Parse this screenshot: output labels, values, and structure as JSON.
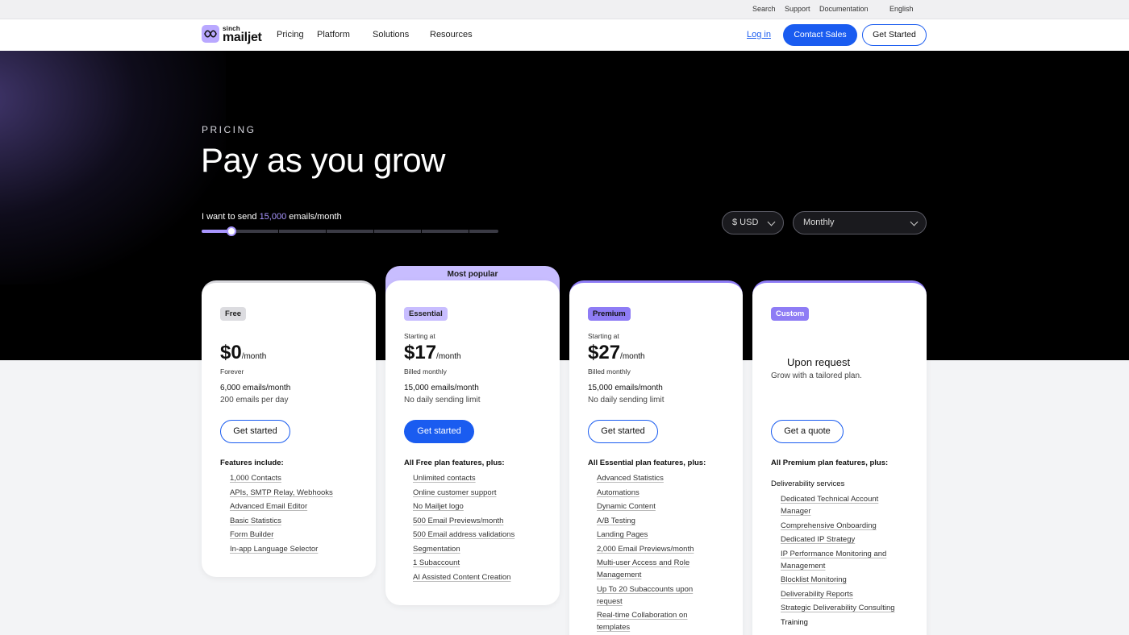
{
  "utility": {
    "search": "Search",
    "support": "Support",
    "documentation": "Documentation",
    "language": "English"
  },
  "nav": {
    "logo_brand": "sinch",
    "logo_name": "mailjet",
    "links": [
      "Pricing",
      "Platform",
      "Solutions",
      "Resources"
    ],
    "login": "Log in",
    "contact": "Contact Sales",
    "get_started": "Get Started"
  },
  "hero": {
    "eyebrow": "PRICING",
    "title": "Pay as you grow",
    "send_prefix": "I want to send",
    "send_value": "15,000",
    "send_suffix": "emails/month",
    "slider_fraction": 0.1,
    "currency": "$ USD",
    "billing": "Monthly"
  },
  "colors": {
    "primary": "#1a5cf0",
    "accent": "#8e7cf5",
    "accent_light": "#c8bdff"
  },
  "plans": {
    "most_popular": "Most popular",
    "free": {
      "badge": "Free",
      "price": "$0",
      "per": "/month",
      "note": "Forever",
      "emails": "6,000 emails/month",
      "limit": "200 emails per day",
      "cta": "Get started",
      "features_head": "Features include:",
      "features": [
        "1,000 Contacts",
        "APIs, SMTP Relay, Webhooks",
        "Advanced Email Editor",
        "Basic Statistics",
        "Form Builder",
        "In-app Language Selector"
      ]
    },
    "essential": {
      "badge": "Essential",
      "starting": "Starting at",
      "price": "$17",
      "per": "/month",
      "note": "Billed monthly",
      "emails": "15,000 emails/month",
      "limit": "No daily sending limit",
      "cta": "Get started",
      "features_head": "All Free plan features, plus:",
      "features": [
        "Unlimited contacts",
        "Online customer support",
        "No Mailjet logo",
        "500 Email Previews/month",
        "500 Email address validations",
        "Segmentation",
        "1 Subaccount",
        "AI Assisted Content Creation"
      ]
    },
    "premium": {
      "badge": "Premium",
      "starting": "Starting at",
      "price": "$27",
      "per": "/month",
      "note": "Billed monthly",
      "emails": "15,000 emails/month",
      "limit": "No daily sending limit",
      "cta": "Get started",
      "features_head": "All Essential plan features, plus:",
      "features": [
        "Advanced Statistics",
        "Automations",
        "Dynamic Content",
        "A/B Testing",
        "Landing Pages",
        "2,000 Email Previews/month"
      ],
      "features_wrapped": [
        [
          "Multi-user Access and Role",
          "Management"
        ],
        [
          "Up To 20 Subaccounts upon",
          "request"
        ],
        [
          "Real-time Collaboration on",
          "templates"
        ]
      ]
    },
    "custom": {
      "badge": "Custom",
      "price_text": "Upon request",
      "tagline": "Grow with a tailored plan.",
      "cta": "Get a quote",
      "features_head": "All Premium plan features, plus:",
      "section": "Deliverability services",
      "features_wrapped": [
        [
          "Dedicated Technical Account",
          "Manager"
        ],
        [
          "Comprehensive Onboarding"
        ],
        [
          "Dedicated IP Strategy"
        ],
        [
          "IP Performance Monitoring and",
          "Management"
        ],
        [
          "Blocklist Monitoring"
        ],
        [
          "Deliverability Reports"
        ],
        [
          "Strategic Deliverability Consulting"
        ]
      ],
      "last_item": "Training"
    }
  }
}
